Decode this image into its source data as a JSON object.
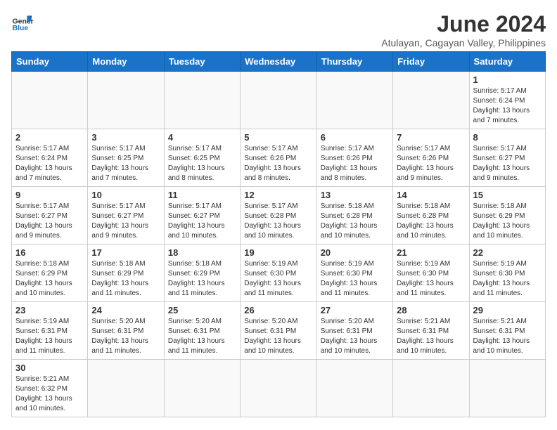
{
  "logo": {
    "text_general": "General",
    "text_blue": "Blue"
  },
  "title": "June 2024",
  "subtitle": "Atulayan, Cagayan Valley, Philippines",
  "days_of_week": [
    "Sunday",
    "Monday",
    "Tuesday",
    "Wednesday",
    "Thursday",
    "Friday",
    "Saturday"
  ],
  "weeks": [
    [
      {
        "day": "",
        "info": ""
      },
      {
        "day": "",
        "info": ""
      },
      {
        "day": "",
        "info": ""
      },
      {
        "day": "",
        "info": ""
      },
      {
        "day": "",
        "info": ""
      },
      {
        "day": "",
        "info": ""
      },
      {
        "day": "1",
        "info": "Sunrise: 5:17 AM\nSunset: 6:24 PM\nDaylight: 13 hours and 7 minutes."
      }
    ],
    [
      {
        "day": "2",
        "info": "Sunrise: 5:17 AM\nSunset: 6:24 PM\nDaylight: 13 hours and 7 minutes."
      },
      {
        "day": "3",
        "info": "Sunrise: 5:17 AM\nSunset: 6:25 PM\nDaylight: 13 hours and 7 minutes."
      },
      {
        "day": "4",
        "info": "Sunrise: 5:17 AM\nSunset: 6:25 PM\nDaylight: 13 hours and 8 minutes."
      },
      {
        "day": "5",
        "info": "Sunrise: 5:17 AM\nSunset: 6:26 PM\nDaylight: 13 hours and 8 minutes."
      },
      {
        "day": "6",
        "info": "Sunrise: 5:17 AM\nSunset: 6:26 PM\nDaylight: 13 hours and 8 minutes."
      },
      {
        "day": "7",
        "info": "Sunrise: 5:17 AM\nSunset: 6:26 PM\nDaylight: 13 hours and 9 minutes."
      },
      {
        "day": "8",
        "info": "Sunrise: 5:17 AM\nSunset: 6:27 PM\nDaylight: 13 hours and 9 minutes."
      }
    ],
    [
      {
        "day": "9",
        "info": "Sunrise: 5:17 AM\nSunset: 6:27 PM\nDaylight: 13 hours and 9 minutes."
      },
      {
        "day": "10",
        "info": "Sunrise: 5:17 AM\nSunset: 6:27 PM\nDaylight: 13 hours and 9 minutes."
      },
      {
        "day": "11",
        "info": "Sunrise: 5:17 AM\nSunset: 6:27 PM\nDaylight: 13 hours and 10 minutes."
      },
      {
        "day": "12",
        "info": "Sunrise: 5:17 AM\nSunset: 6:28 PM\nDaylight: 13 hours and 10 minutes."
      },
      {
        "day": "13",
        "info": "Sunrise: 5:18 AM\nSunset: 6:28 PM\nDaylight: 13 hours and 10 minutes."
      },
      {
        "day": "14",
        "info": "Sunrise: 5:18 AM\nSunset: 6:28 PM\nDaylight: 13 hours and 10 minutes."
      },
      {
        "day": "15",
        "info": "Sunrise: 5:18 AM\nSunset: 6:29 PM\nDaylight: 13 hours and 10 minutes."
      }
    ],
    [
      {
        "day": "16",
        "info": "Sunrise: 5:18 AM\nSunset: 6:29 PM\nDaylight: 13 hours and 10 minutes."
      },
      {
        "day": "17",
        "info": "Sunrise: 5:18 AM\nSunset: 6:29 PM\nDaylight: 13 hours and 11 minutes."
      },
      {
        "day": "18",
        "info": "Sunrise: 5:18 AM\nSunset: 6:29 PM\nDaylight: 13 hours and 11 minutes."
      },
      {
        "day": "19",
        "info": "Sunrise: 5:19 AM\nSunset: 6:30 PM\nDaylight: 13 hours and 11 minutes."
      },
      {
        "day": "20",
        "info": "Sunrise: 5:19 AM\nSunset: 6:30 PM\nDaylight: 13 hours and 11 minutes."
      },
      {
        "day": "21",
        "info": "Sunrise: 5:19 AM\nSunset: 6:30 PM\nDaylight: 13 hours and 11 minutes."
      },
      {
        "day": "22",
        "info": "Sunrise: 5:19 AM\nSunset: 6:30 PM\nDaylight: 13 hours and 11 minutes."
      }
    ],
    [
      {
        "day": "23",
        "info": "Sunrise: 5:19 AM\nSunset: 6:31 PM\nDaylight: 13 hours and 11 minutes."
      },
      {
        "day": "24",
        "info": "Sunrise: 5:20 AM\nSunset: 6:31 PM\nDaylight: 13 hours and 11 minutes."
      },
      {
        "day": "25",
        "info": "Sunrise: 5:20 AM\nSunset: 6:31 PM\nDaylight: 13 hours and 11 minutes."
      },
      {
        "day": "26",
        "info": "Sunrise: 5:20 AM\nSunset: 6:31 PM\nDaylight: 13 hours and 10 minutes."
      },
      {
        "day": "27",
        "info": "Sunrise: 5:20 AM\nSunset: 6:31 PM\nDaylight: 13 hours and 10 minutes."
      },
      {
        "day": "28",
        "info": "Sunrise: 5:21 AM\nSunset: 6:31 PM\nDaylight: 13 hours and 10 minutes."
      },
      {
        "day": "29",
        "info": "Sunrise: 5:21 AM\nSunset: 6:31 PM\nDaylight: 13 hours and 10 minutes."
      }
    ],
    [
      {
        "day": "30",
        "info": "Sunrise: 5:21 AM\nSunset: 6:32 PM\nDaylight: 13 hours and 10 minutes."
      },
      {
        "day": "",
        "info": ""
      },
      {
        "day": "",
        "info": ""
      },
      {
        "day": "",
        "info": ""
      },
      {
        "day": "",
        "info": ""
      },
      {
        "day": "",
        "info": ""
      },
      {
        "day": "",
        "info": ""
      }
    ]
  ]
}
